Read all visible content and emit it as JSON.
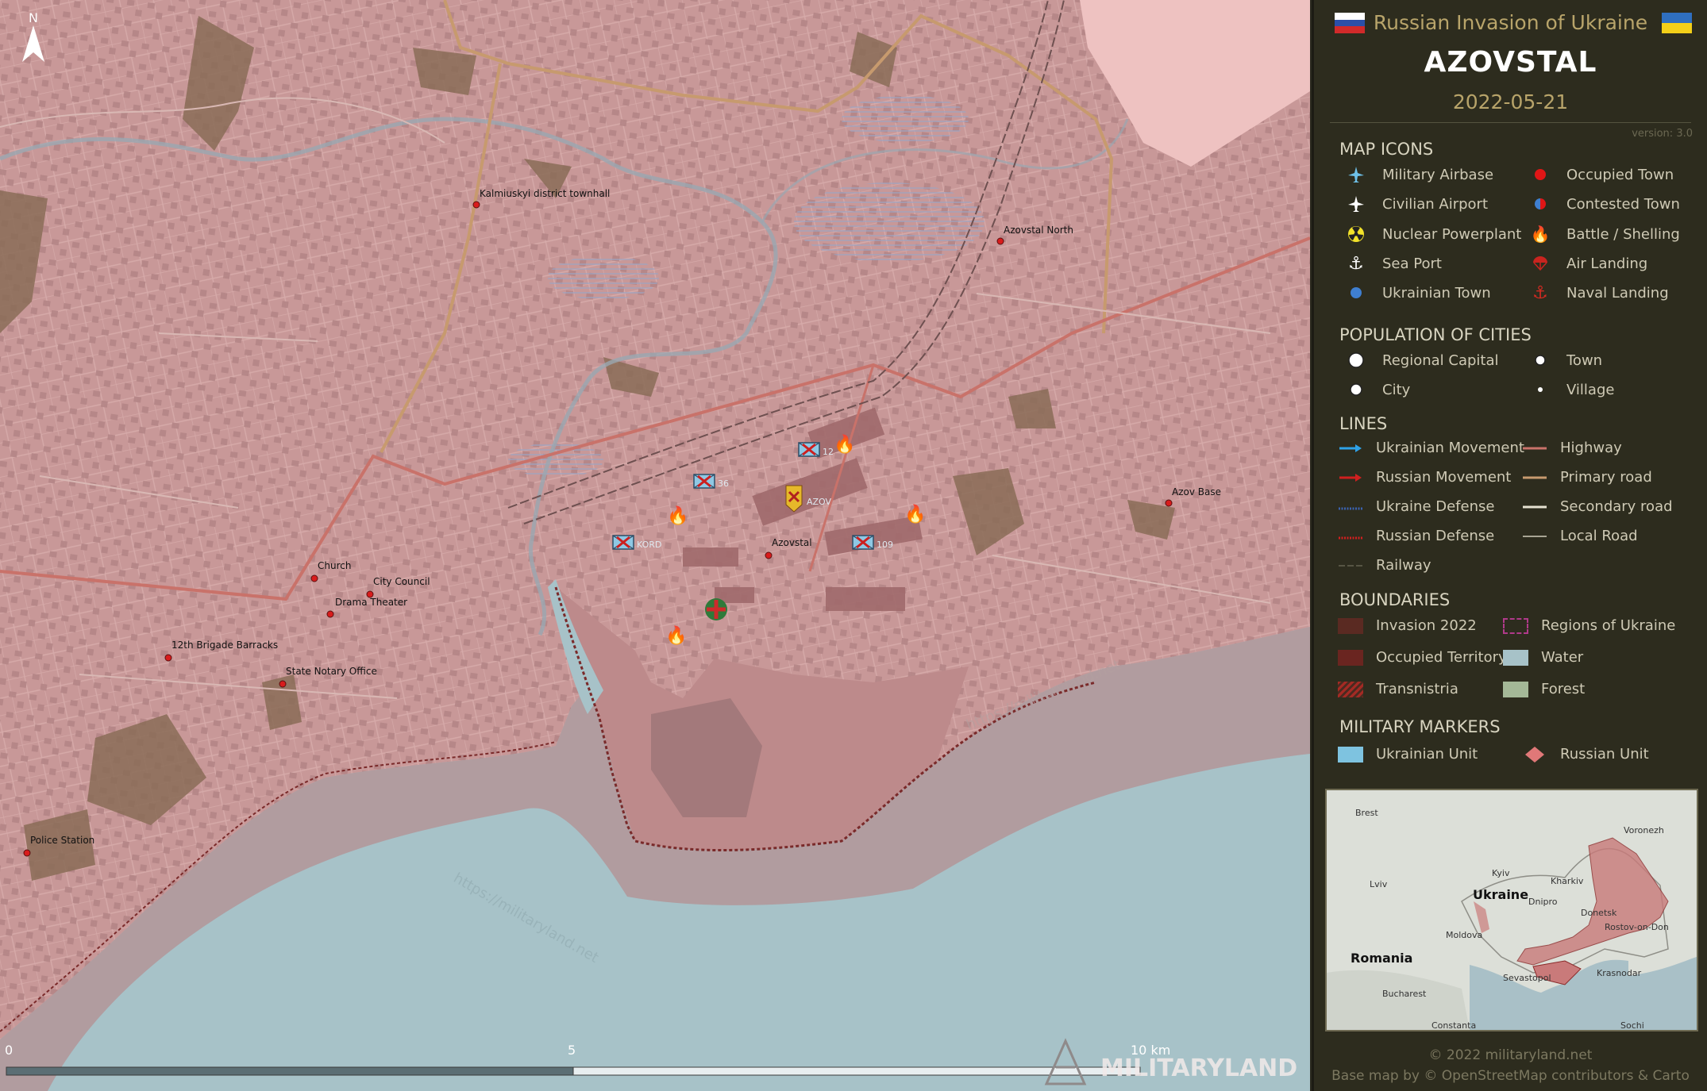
{
  "header": {
    "title": "Russian Invasion of Ukraine",
    "main": "AZOVSTAL",
    "date": "2022-05-21",
    "version": "version: 3.0"
  },
  "legend": {
    "map_icons": {
      "title": "MAP ICONS",
      "left": [
        {
          "label": "Military Airbase",
          "icon": "military-airbase-icon"
        },
        {
          "label": "Civilian Airport",
          "icon": "civilian-airport-icon"
        },
        {
          "label": "Nuclear Powerplant",
          "icon": "nuclear-powerplant-icon"
        },
        {
          "label": "Sea Port",
          "icon": "anchor-icon"
        },
        {
          "label": "Ukrainian Town",
          "icon": "ukrainian-town-icon"
        }
      ],
      "right": [
        {
          "label": "Occupied Town",
          "icon": "occupied-town-icon"
        },
        {
          "label": "Contested Town",
          "icon": "contested-town-icon"
        },
        {
          "label": "Battle / Shelling",
          "icon": "fire-icon"
        },
        {
          "label": "Air Landing",
          "icon": "parachute-icon"
        },
        {
          "label": "Naval Landing",
          "icon": "naval-anchor-icon"
        }
      ]
    },
    "population": {
      "title": "POPULATION OF CITIES",
      "items": [
        "Regional Capital",
        "Town",
        "City",
        "Village"
      ]
    },
    "lines": {
      "title": "LINES",
      "left": [
        "Ukrainian Movement",
        "Russian Movement",
        "Ukraine Defense",
        "Russian Defense",
        "Railway"
      ],
      "right": [
        "Highway",
        "Primary road",
        "Secondary road",
        "Local Road"
      ]
    },
    "boundaries": {
      "title": "BOUNDARIES",
      "left": [
        "Invasion 2022",
        "Occupied Territory",
        "Transnistria"
      ],
      "right": [
        "Regions of Ukraine",
        "Water",
        "Forest"
      ]
    },
    "military": {
      "title": "MILITARY MARKERS",
      "left": "Ukrainian Unit",
      "right": "Russian Unit"
    }
  },
  "inset": {
    "labels": [
      "Brest",
      "Voronezh",
      "Kyiv",
      "Kharkiv",
      "Lviv",
      "Ukraine",
      "Dnipro",
      "Donetsk",
      "Rostov-on-Don",
      "Moldova",
      "Romania",
      "Sevastopol",
      "Krasnodar",
      "Bucharest",
      "Constanta",
      "Sochi"
    ]
  },
  "map": {
    "places": [
      "Kalmiuskyi district townhall",
      "Azovstal North",
      "Azov Base",
      "Church",
      "City Council",
      "Drama Theater",
      "12th Brigade Barracks",
      "State Notary Office",
      "Police Station",
      "Azovstal"
    ],
    "units": [
      "12",
      "36",
      "AZOV",
      "KORD",
      "109"
    ],
    "scale": {
      "start": "0",
      "mid": "5",
      "end": "10 km"
    },
    "north": "N",
    "watermark": "https://militaryland.net",
    "brand": "MILITARYLAND"
  },
  "footer": {
    "copyright": "© 2022 militaryland.net",
    "basemap": "Base map by © OpenStreetMap contributors & Carto"
  },
  "colors": {
    "occupied": "#c4888a",
    "water": "#a7c2c8",
    "panel_bg": "#2d2c1e",
    "accent_gold": "#b8a46a"
  }
}
